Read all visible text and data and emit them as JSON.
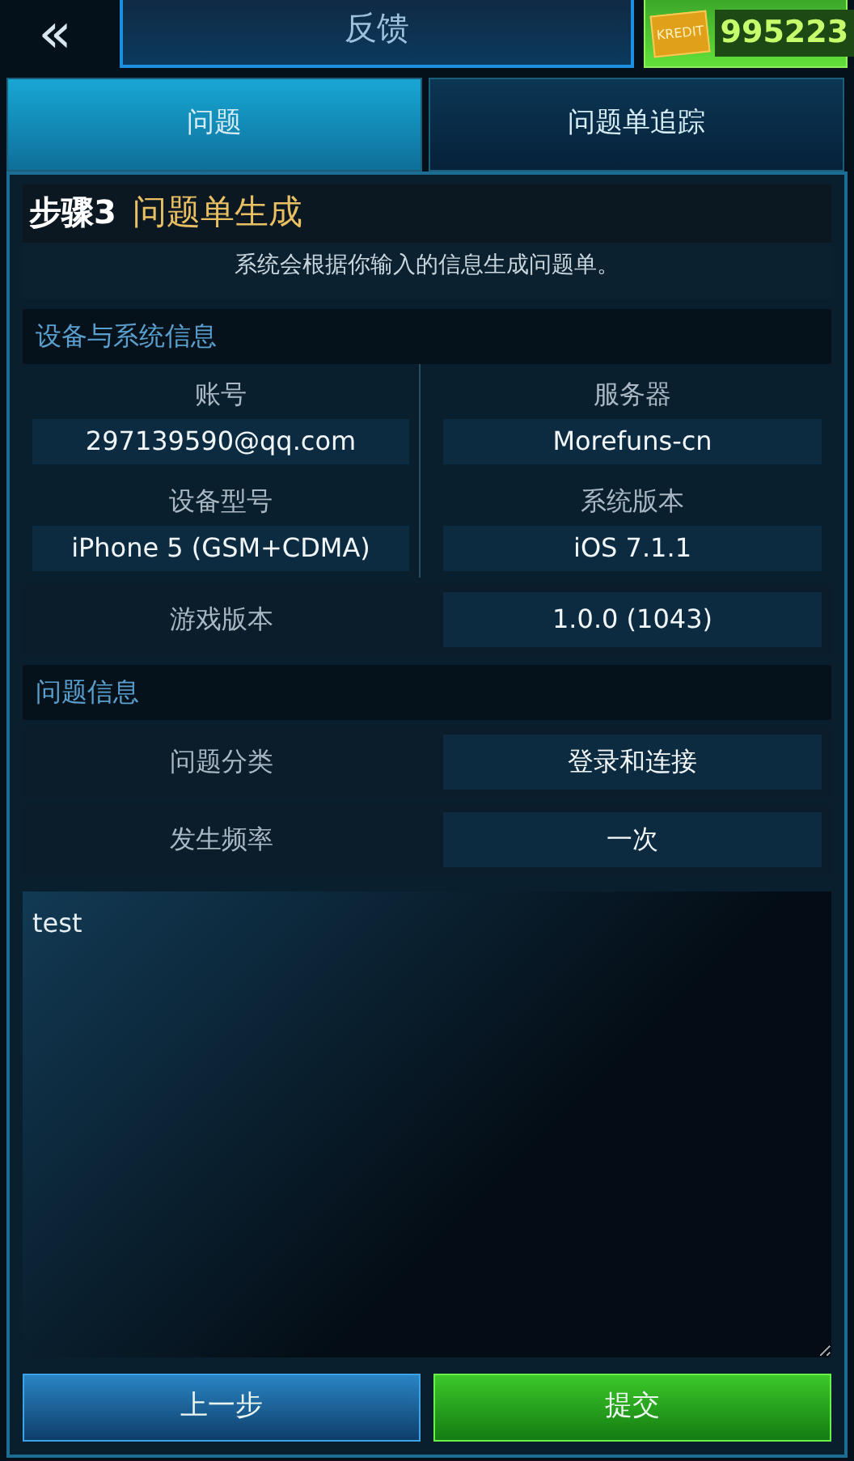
{
  "header": {
    "back": "«",
    "title": "反馈",
    "credits_label": "KREDIT",
    "credits": "995223"
  },
  "tabs": [
    {
      "label": "问题",
      "selected": true
    },
    {
      "label": "问题单追踪",
      "selected": false
    }
  ],
  "step": {
    "number": "步骤3",
    "title": "问题单生成",
    "description": "系统会根据你输入的信息生成问题单。"
  },
  "device_section": {
    "title": "设备与系统信息",
    "pairs": [
      {
        "label": "账号",
        "value": "297139590@qq.com"
      },
      {
        "label": "服务器",
        "value": "Morefuns-cn"
      },
      {
        "label": "设备型号",
        "value": "iPhone 5 (GSM+CDMA)"
      },
      {
        "label": "系统版本",
        "value": "iOS 7.1.1"
      }
    ],
    "rows": [
      {
        "label": "游戏版本",
        "value": "1.0.0 (1043)"
      }
    ]
  },
  "issue_section": {
    "title": "问题信息",
    "rows": [
      {
        "label": "问题分类",
        "value": "登录和连接"
      },
      {
        "label": "发生频率",
        "value": "一次"
      }
    ]
  },
  "description_box": {
    "value": "test"
  },
  "buttons": [
    {
      "label": "上一步",
      "kind": "secondary"
    },
    {
      "label": "提交",
      "kind": "primary"
    }
  ]
}
